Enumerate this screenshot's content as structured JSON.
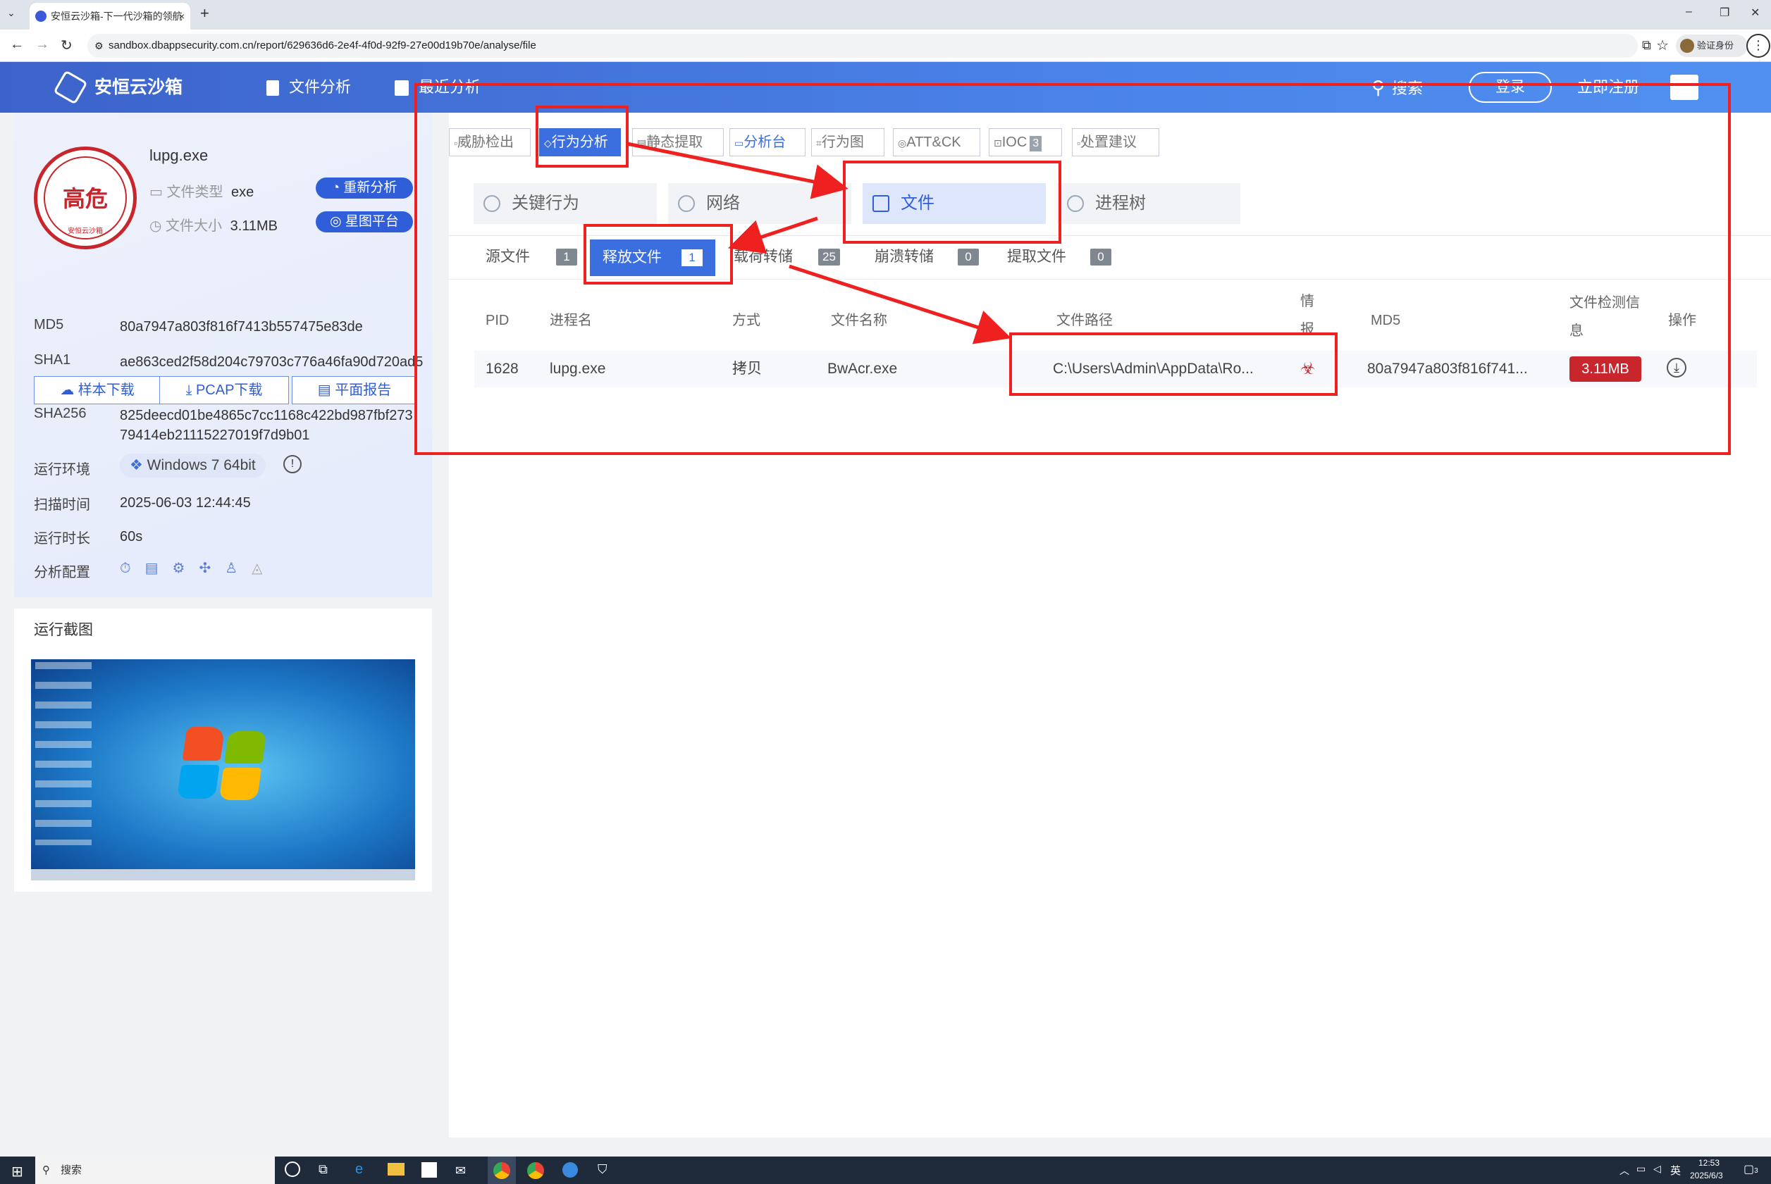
{
  "browser": {
    "tab_title": "安恒云沙箱-下一代沙箱的领航",
    "tab_close": "×",
    "new_tab": "+",
    "url": "sandbox.dbappsecurity.com.cn/report/629636d6-2e4f-4f0d-92f9-27e00d19b70e/analyse/file",
    "profile_label": "验证身份",
    "window_controls": [
      "–",
      "❐",
      "✕"
    ]
  },
  "header": {
    "logo": "安恒云沙箱",
    "nav": [
      "文件分析",
      "最近分析"
    ],
    "search": "搜索",
    "login": "登录",
    "register": "立即注册"
  },
  "sample": {
    "risk": "高危",
    "seal_text": "安恒云沙箱",
    "filename": "lupg.exe",
    "file_type_label": "文件类型",
    "file_type": "exe",
    "file_size_label": "文件大小",
    "file_size": "3.11MB",
    "reanalyze": "重新分析",
    "star_platform": "星图平台",
    "downloads": [
      "样本下载",
      "PCAP下载",
      "平面报告"
    ],
    "meta": [
      {
        "label": "MD5",
        "value": "80a7947a803f816f7413b557475e83de"
      },
      {
        "label": "SHA1",
        "value": "ae863ced2f58d204c79703c776a46fa90d720ad5"
      },
      {
        "label": "SHA256",
        "value": "825deecd01be4865c7cc1168c422bd987fbf27379414eb21115227019f7d9b01"
      },
      {
        "label": "运行环境",
        "value": "Windows 7 64bit"
      },
      {
        "label": "扫描时间",
        "value": "2025-06-03 12:44:45"
      },
      {
        "label": "运行时长",
        "value": "60s"
      },
      {
        "label": "分析配置",
        "value": ""
      }
    ],
    "screenshot_title": "运行截图"
  },
  "main_tabs": [
    {
      "label": "威胁检出",
      "active": false
    },
    {
      "label": "行为分析",
      "active": true
    },
    {
      "label": "静态提取",
      "active": false
    },
    {
      "label": "分析台",
      "active": false
    },
    {
      "label": "行为图",
      "active": false
    },
    {
      "label": "ATT&CK",
      "active": false
    },
    {
      "label": "IOC",
      "badge": "3",
      "active": false
    },
    {
      "label": "处置建议",
      "active": false
    }
  ],
  "sub_tabs": [
    "关键行为",
    "网络",
    "文件",
    "进程树"
  ],
  "file_categories": [
    {
      "label": "源文件",
      "count": "1"
    },
    {
      "label": "释放文件",
      "count": "1"
    },
    {
      "label": "载荷转储",
      "count": "25"
    },
    {
      "label": "崩溃转储",
      "count": "0"
    },
    {
      "label": "提取文件",
      "count": "0"
    }
  ],
  "table": {
    "headers": [
      "PID",
      "进程名",
      "方式",
      "文件名称",
      "文件路径",
      "情报",
      "MD5",
      "文件检测信息",
      "操作"
    ],
    "rows": [
      {
        "pid": "1628",
        "process": "lupg.exe",
        "method": "拷贝",
        "filename": "BwAcr.exe",
        "path": "C:\\Users\\Admin\\AppData\\Ro...",
        "intel": "☣",
        "md5": "80a7947a803f816f741...",
        "detect": "3.11MB",
        "action": "⤓"
      }
    ]
  },
  "taskbar": {
    "search": "搜索",
    "lang": "英",
    "time": "12:53",
    "date": "2025/6/3",
    "notify": "3"
  },
  "colors": {
    "header_blue": "#4a7de6",
    "accent": "#3b6fe0",
    "annotation_red": "#ee2020",
    "risk_red": "#c8252c"
  }
}
